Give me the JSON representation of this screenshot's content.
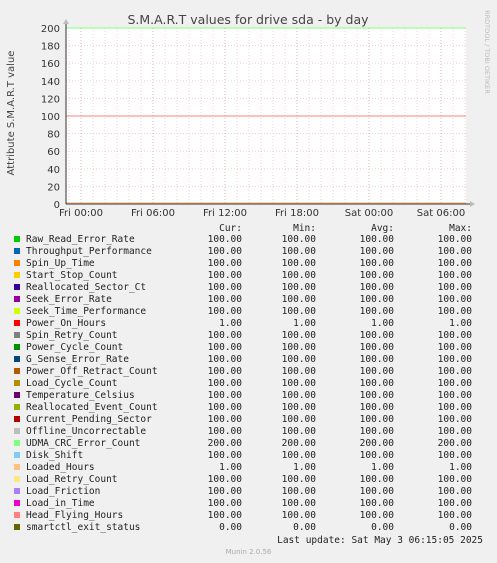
{
  "chart_data": {
    "type": "line",
    "title": "S.M.A.R.T values for drive sda - by day",
    "ylabel": "Attribute S.M.A.R.T value",
    "side_label": "RRDTOOL / TOBI OETIKER",
    "ylim": [
      0,
      200
    ],
    "y_ticks": [
      "0",
      "20",
      "40",
      "60",
      "80",
      "100",
      "120",
      "140",
      "160",
      "180",
      "200"
    ],
    "x_ticks": [
      "Fri 00:00",
      "Fri 06:00",
      "Fri 12:00",
      "Fri 18:00",
      "Sat 00:00",
      "Sat 06:00"
    ],
    "series": [
      {
        "name": "Raw_Read_Error_Rate",
        "color": "#00cc00",
        "cur": "100.00",
        "min": "100.00",
        "avg": "100.00",
        "max": "100.00",
        "value": 100
      },
      {
        "name": "Throughput_Performance",
        "color": "#0066b3",
        "cur": "100.00",
        "min": "100.00",
        "avg": "100.00",
        "max": "100.00",
        "value": 100
      },
      {
        "name": "Spin_Up_Time",
        "color": "#ff8000",
        "cur": "100.00",
        "min": "100.00",
        "avg": "100.00",
        "max": "100.00",
        "value": 100
      },
      {
        "name": "Start_Stop_Count",
        "color": "#ffcc00",
        "cur": "100.00",
        "min": "100.00",
        "avg": "100.00",
        "max": "100.00",
        "value": 100
      },
      {
        "name": "Reallocated_Sector_Ct",
        "color": "#330099",
        "cur": "100.00",
        "min": "100.00",
        "avg": "100.00",
        "max": "100.00",
        "value": 100
      },
      {
        "name": "Seek_Error_Rate",
        "color": "#990099",
        "cur": "100.00",
        "min": "100.00",
        "avg": "100.00",
        "max": "100.00",
        "value": 100
      },
      {
        "name": "Seek_Time_Performance",
        "color": "#ccff00",
        "cur": "100.00",
        "min": "100.00",
        "avg": "100.00",
        "max": "100.00",
        "value": 100
      },
      {
        "name": "Power_On_Hours",
        "color": "#ff0000",
        "cur": "1.00",
        "min": "1.00",
        "avg": "1.00",
        "max": "1.00",
        "value": 1
      },
      {
        "name": "Spin_Retry_Count",
        "color": "#808080",
        "cur": "100.00",
        "min": "100.00",
        "avg": "100.00",
        "max": "100.00",
        "value": 100
      },
      {
        "name": "Power_Cycle_Count",
        "color": "#008f00",
        "cur": "100.00",
        "min": "100.00",
        "avg": "100.00",
        "max": "100.00",
        "value": 100
      },
      {
        "name": "G_Sense_Error_Rate",
        "color": "#00487d",
        "cur": "100.00",
        "min": "100.00",
        "avg": "100.00",
        "max": "100.00",
        "value": 100
      },
      {
        "name": "Power_Off_Retract_Count",
        "color": "#b35a00",
        "cur": "100.00",
        "min": "100.00",
        "avg": "100.00",
        "max": "100.00",
        "value": 100
      },
      {
        "name": "Load_Cycle_Count",
        "color": "#b38f00",
        "cur": "100.00",
        "min": "100.00",
        "avg": "100.00",
        "max": "100.00",
        "value": 100
      },
      {
        "name": "Temperature_Celsius",
        "color": "#6b006b",
        "cur": "100.00",
        "min": "100.00",
        "avg": "100.00",
        "max": "100.00",
        "value": 100
      },
      {
        "name": "Reallocated_Event_Count",
        "color": "#8fb300",
        "cur": "100.00",
        "min": "100.00",
        "avg": "100.00",
        "max": "100.00",
        "value": 100
      },
      {
        "name": "Current_Pending_Sector",
        "color": "#b30000",
        "cur": "100.00",
        "min": "100.00",
        "avg": "100.00",
        "max": "100.00",
        "value": 100
      },
      {
        "name": "Offline_Uncorrectable",
        "color": "#bebebe",
        "cur": "100.00",
        "min": "100.00",
        "avg": "100.00",
        "max": "100.00",
        "value": 100
      },
      {
        "name": "UDMA_CRC_Error_Count",
        "color": "#80ff80",
        "cur": "200.00",
        "min": "200.00",
        "avg": "200.00",
        "max": "200.00",
        "value": 200
      },
      {
        "name": "Disk_Shift",
        "color": "#80c9ff",
        "cur": "100.00",
        "min": "100.00",
        "avg": "100.00",
        "max": "100.00",
        "value": 100
      },
      {
        "name": "Loaded_Hours",
        "color": "#ffc080",
        "cur": "1.00",
        "min": "1.00",
        "avg": "1.00",
        "max": "1.00",
        "value": 1
      },
      {
        "name": "Load_Retry_Count",
        "color": "#ffe680",
        "cur": "100.00",
        "min": "100.00",
        "avg": "100.00",
        "max": "100.00",
        "value": 100
      },
      {
        "name": "Load_Friction",
        "color": "#aa80ff",
        "cur": "100.00",
        "min": "100.00",
        "avg": "100.00",
        "max": "100.00",
        "value": 100
      },
      {
        "name": "Load_in_Time",
        "color": "#ee00cc",
        "cur": "100.00",
        "min": "100.00",
        "avg": "100.00",
        "max": "100.00",
        "value": 100
      },
      {
        "name": "Head_Flying_Hours",
        "color": "#ff8080",
        "cur": "100.00",
        "min": "100.00",
        "avg": "100.00",
        "max": "100.00",
        "value": 100
      },
      {
        "name": "smartctl_exit_status",
        "color": "#666600",
        "cur": "0.00",
        "min": "0.00",
        "avg": "0.00",
        "max": "0.00",
        "value": 0
      }
    ]
  },
  "legend_headers": {
    "cur": "Cur:",
    "min": "Min:",
    "avg": "Avg:",
    "max": "Max:"
  },
  "last_update": "Last update: Sat May  3 06:15:05 2025",
  "footer": "Munin 2.0.56"
}
